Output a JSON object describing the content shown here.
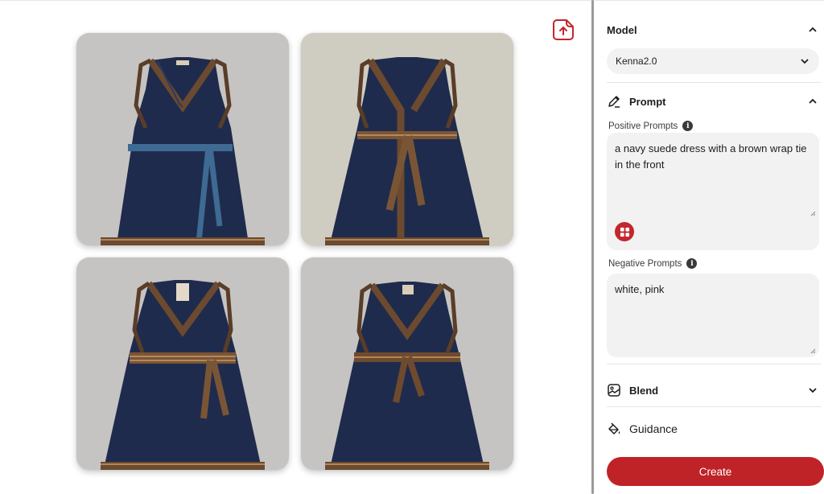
{
  "colors": {
    "accent": "#bf2328",
    "navy": "#1e2a4a",
    "brown": "#6e4a2e"
  },
  "gallery": {
    "images": [
      {
        "name": "generated-image-1"
      },
      {
        "name": "generated-image-2"
      },
      {
        "name": "generated-image-3"
      },
      {
        "name": "generated-image-4"
      }
    ],
    "upload_icon": "upload-icon"
  },
  "panel": {
    "model": {
      "title": "Model",
      "selected": "Kenna2.0"
    },
    "prompt": {
      "title": "Prompt",
      "positive_label": "Positive Prompts",
      "positive_value": "a navy suede dress with a brown wrap tie in the front",
      "negative_label": "Negative Prompts",
      "negative_value": "white, pink"
    },
    "blend": {
      "title": "Blend"
    },
    "guidance": {
      "title": "Guidance"
    },
    "create_label": "Create"
  }
}
